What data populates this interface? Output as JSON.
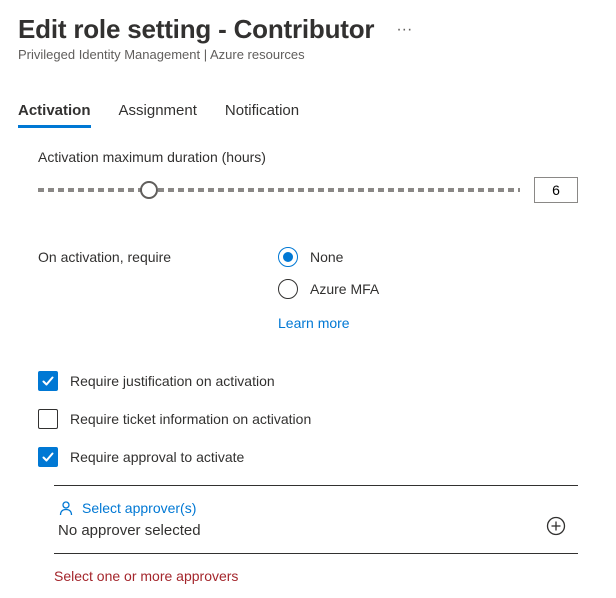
{
  "header": {
    "title": "Edit role setting - Contributor",
    "breadcrumb": "Privileged Identity Management | Azure resources"
  },
  "tabs": {
    "activation": "Activation",
    "assignment": "Assignment",
    "notification": "Notification"
  },
  "activation": {
    "duration_label": "Activation maximum duration (hours)",
    "duration_value": "6",
    "slider_percent": 23,
    "on_activation_require_label": "On activation, require",
    "radio_none": "None",
    "radio_mfa": "Azure MFA",
    "radio_selected": "none",
    "learn_more": "Learn more",
    "check_justification": "Require justification on activation",
    "check_justification_checked": true,
    "check_ticket": "Require ticket information on activation",
    "check_ticket_checked": false,
    "check_approval": "Require approval to activate",
    "check_approval_checked": true,
    "select_approvers_label": "Select approver(s)",
    "no_approver_text": "No approver selected",
    "error_text": "Select one or more approvers"
  }
}
